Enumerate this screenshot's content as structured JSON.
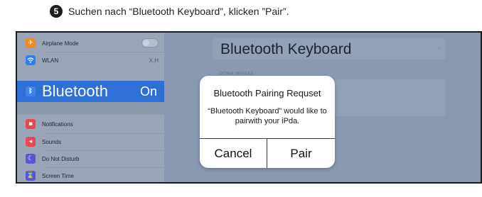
{
  "step": {
    "number": "5",
    "instruction": "Suchen nach “Bluetooth Keyboard”, klicken ”Pair”."
  },
  "sidebar": {
    "items": [
      {
        "label": "Airplane Mode",
        "icon": "airplane-icon",
        "color": "#f08a24"
      },
      {
        "label": "WLAN",
        "value": "X,H",
        "icon": "wifi-icon",
        "color": "#2f80ed"
      },
      {
        "label": "Bluetooth",
        "value": "On",
        "icon": "bluetooth-icon",
        "color": "#3d86f0",
        "selected": true
      },
      {
        "label": "Notifications",
        "icon": "notifications-icon",
        "color": "#e5484d"
      },
      {
        "label": "Sounds",
        "icon": "sounds-icon",
        "color": "#e5484d"
      },
      {
        "label": "Do Not Disturb",
        "icon": "moon-icon",
        "color": "#5856d6"
      },
      {
        "label": "Screen Time",
        "icon": "hourglass-icon",
        "color": "#5856d6"
      }
    ]
  },
  "detail": {
    "title": "Bluetooth Keyboard",
    "section_label": "OTHER DEVICES"
  },
  "alert": {
    "title": "Bluetooth Pairing Requset",
    "message": "“Bluetooth Keyboard” would like to pairwith your iPda.",
    "cancel_label": "Cancel",
    "pair_label": "Pair"
  },
  "colors": {
    "selected_row": "#2f6fd8",
    "sidebar_bg": "#9aa6b8",
    "detail_bg": "#8a99b0",
    "frame_border": "#1b1b1b"
  }
}
